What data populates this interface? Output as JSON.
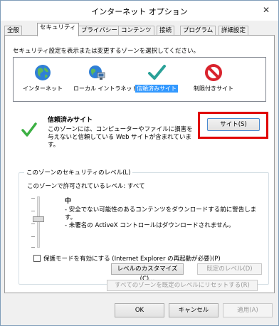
{
  "window": {
    "title": "インターネット オプション",
    "close_glyph": "✕"
  },
  "tabs": [
    {
      "label": "全般"
    },
    {
      "label": "セキュリティ"
    },
    {
      "label": "プライバシー"
    },
    {
      "label": "コンテンツ"
    },
    {
      "label": "接続"
    },
    {
      "label": "プログラム"
    },
    {
      "label": "詳細設定"
    }
  ],
  "security": {
    "instruction": "セキュリティ設定を表示または変更するゾーンを選択してください。",
    "zones": [
      {
        "label": "インターネット",
        "icon": "globe-icon"
      },
      {
        "label": "ローカル イントラネット",
        "icon": "intranet-icon"
      },
      {
        "label": "信頼済みサイト",
        "icon": "checkmark-icon",
        "selected": true
      },
      {
        "label": "制限付きサイト",
        "icon": "prohibited-icon"
      }
    ],
    "zone_title": "信頼済みサイト",
    "zone_description": "このゾーンには、コンピューターやファイルに損害を与えないと信頼している Web サイトが含まれています。",
    "sites_button": "サイト(S)",
    "level_group_label": "このゾーンのセキュリティのレベル(L)",
    "allowed_levels": "このゾーンで許可されているレベル: すべて",
    "level_name": "中",
    "level_desc_1": "- 安全でない可能性のあるコンテンツをダウンロードする前に警告します。",
    "level_desc_2": "- 未署名の ActiveX コントロールはダウンロードされません。",
    "protected_mode_label": "保護モードを有効にする (Internet Explorer の再起動が必要)(P)",
    "protected_mode_checked": false,
    "custom_level_button": "レベルのカスタマイズ(C)...",
    "default_level_button": "既定のレベル(D)",
    "reset_all_button": "すべてのゾーンを既定のレベルにリセットする(R)"
  },
  "footer": {
    "ok_button": "OK",
    "cancel_button": "キャンセル",
    "apply_button": "適用(A)"
  },
  "colors": {
    "highlight": "#e00000",
    "selection": "#3399ff"
  }
}
